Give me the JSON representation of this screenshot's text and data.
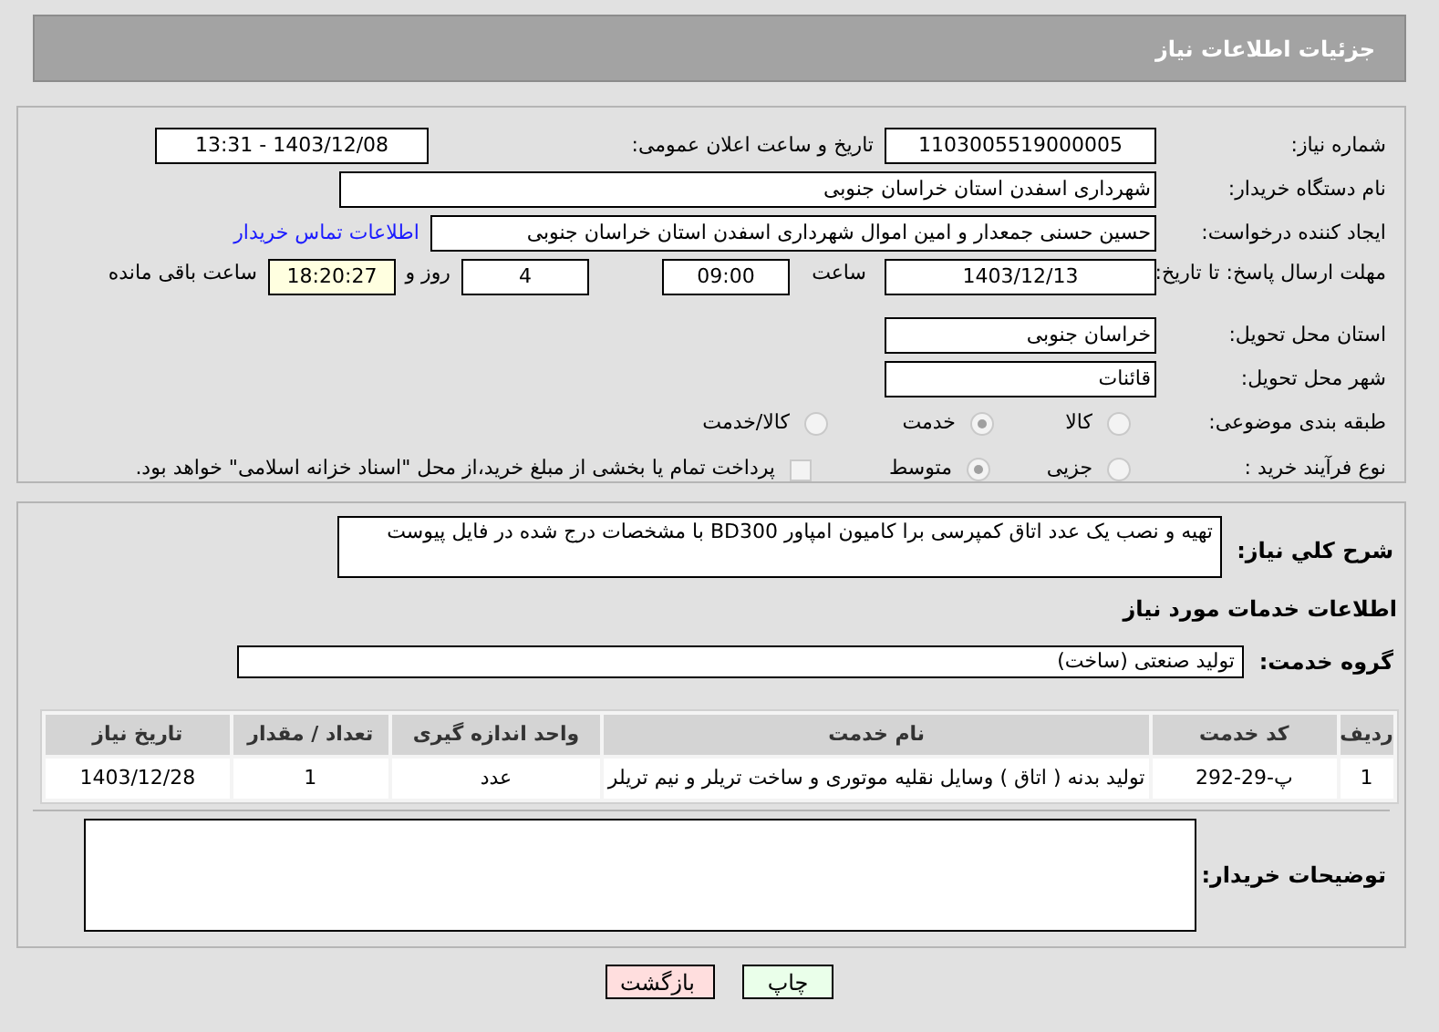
{
  "header": {
    "title": "جزئیات اطلاعات نیاز"
  },
  "details": {
    "need_number": {
      "label": "شماره نیاز:",
      "value": "1103005519000005"
    },
    "announce": {
      "label": "تاریخ و ساعت اعلان عمومی:",
      "value": "1403/12/08 - 13:31"
    },
    "buyer_org": {
      "label": "نام دستگاه خریدار:",
      "value": "شهرداری اسفدن استان خراسان جنوبی"
    },
    "creator": {
      "label": "ایجاد کننده درخواست:",
      "value": "حسین حسنی جمعدار و امین اموال شهرداری اسفدن استان خراسان جنوبی",
      "link": "اطلاعات تماس خریدار"
    },
    "deadline": {
      "label": "مهلت ارسال پاسخ: تا تاریخ:",
      "date": "1403/12/13",
      "time_label": "ساعت",
      "time": "09:00",
      "days": "4",
      "days_label": "روز و",
      "remaining": "18:20:27",
      "remaining_label": "ساعت باقی مانده"
    },
    "province": {
      "label": "استان محل تحویل:",
      "value": "خراسان جنوبی"
    },
    "city": {
      "label": "شهر محل تحویل:",
      "value": "قائنات"
    },
    "category": {
      "label": "طبقه بندی موضوعی:",
      "options": [
        {
          "label": "کالا",
          "selected": false
        },
        {
          "label": "خدمت",
          "selected": true
        },
        {
          "label": "کالا/خدمت",
          "selected": false
        }
      ]
    },
    "purchase_type": {
      "label": "نوع فرآیند خرید :",
      "options": [
        {
          "label": "جزیی",
          "selected": false
        },
        {
          "label": "متوسط",
          "selected": true
        }
      ],
      "treasury": {
        "checked": false,
        "label": "پرداخت تمام یا بخشی از مبلغ خرید،از محل \"اسناد خزانه اسلامی\" خواهد بود."
      }
    }
  },
  "services": {
    "description": {
      "label": "شرح کلي نیاز:",
      "value": "تهیه و نصب یک عدد اتاق کمپرسی برا کامیون امپاور BD300 با مشخصات درج شده در فایل پیوست"
    },
    "section_title": "اطلاعات خدمات مورد نیاز",
    "group": {
      "label": "گروه خدمت:",
      "value": "تولید صنعتی (ساخت)"
    },
    "table": {
      "columns": [
        "ردیف",
        "کد خدمت",
        "نام خدمت",
        "واحد اندازه گیری",
        "تعداد / مقدار",
        "تاریخ نیاز"
      ],
      "rows": [
        [
          "1",
          "پ-29-292",
          "تولید بدنه ( اتاق ) وسایل نقلیه موتوری و ساخت تریلر و نیم تریلر",
          "عدد",
          "1",
          "1403/12/28"
        ]
      ]
    },
    "buyer_notes": {
      "label": "توضیحات خریدار:"
    }
  },
  "buttons": [
    {
      "label": "چاپ",
      "kind": "print"
    },
    {
      "label": "بازگشت",
      "kind": "back"
    }
  ]
}
